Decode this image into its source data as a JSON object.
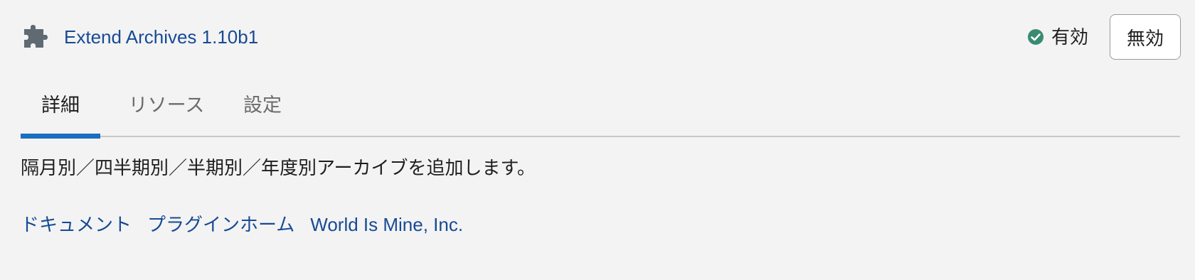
{
  "plugin": {
    "title": "Extend Archives 1.10b1",
    "icon": "puzzle-piece-icon",
    "status_icon": "check-circle-icon",
    "status_label": "有効",
    "disable_label": "無効"
  },
  "tabs": [
    {
      "label": "詳細",
      "active": true
    },
    {
      "label": "リソース",
      "active": false
    },
    {
      "label": "設定",
      "active": false
    }
  ],
  "description": "隔月別／四半期別／半期別／年度別アーカイブを追加します。",
  "links": [
    {
      "label": "ドキュメント"
    },
    {
      "label": "プラグインホーム"
    },
    {
      "label": "World Is Mine, Inc."
    }
  ],
  "colors": {
    "background": "#f3f3f3",
    "link": "#174a95",
    "accent": "#1a6fc1",
    "status_ok": "#3a8a72"
  }
}
